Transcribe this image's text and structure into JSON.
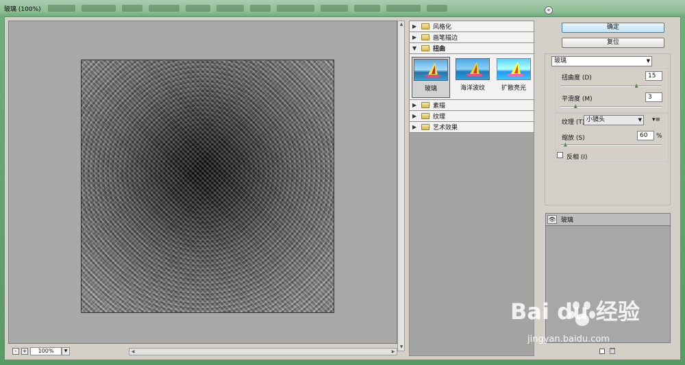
{
  "window": {
    "title": "玻璃 (100%)"
  },
  "preview": {
    "zoom": "100%",
    "zoom_out": "-",
    "zoom_in": "+"
  },
  "filter_list": {
    "categories": [
      {
        "label": "风格化",
        "expanded": false
      },
      {
        "label": "画笔描边",
        "expanded": false
      },
      {
        "label": "扭曲",
        "expanded": true
      },
      {
        "label": "素描",
        "expanded": false
      },
      {
        "label": "纹理",
        "expanded": false
      },
      {
        "label": "艺术效果",
        "expanded": false
      }
    ],
    "thumbnails": [
      {
        "label": "玻璃",
        "selected": true
      },
      {
        "label": "海洋波纹",
        "selected": false
      },
      {
        "label": "扩散亮光",
        "selected": false
      }
    ]
  },
  "buttons": {
    "ok": "确定",
    "reset": "复位"
  },
  "settings": {
    "filter_select": "玻璃",
    "distortion": {
      "label": "扭曲度 (D)",
      "value": "15",
      "fraction": 0.75
    },
    "smoothness": {
      "label": "平滑度 (M)",
      "value": "3",
      "fraction": 0.15
    },
    "texture": {
      "label": "纹理 (T):",
      "value": "小镜头"
    },
    "scaling": {
      "label": "缩放 (S)",
      "value": "60",
      "unit": "%",
      "fraction": 0.05
    },
    "invert": {
      "label": "反相 (I)",
      "checked": false
    }
  },
  "layers": {
    "items": [
      {
        "label": "玻璃",
        "visible": true
      }
    ]
  },
  "watermark": {
    "brand": "Bai du 经验",
    "url": "jingyan.baidu.com"
  },
  "colors": {
    "primary_button": "#bfe3f7",
    "window_frame": "#5a9a63"
  }
}
